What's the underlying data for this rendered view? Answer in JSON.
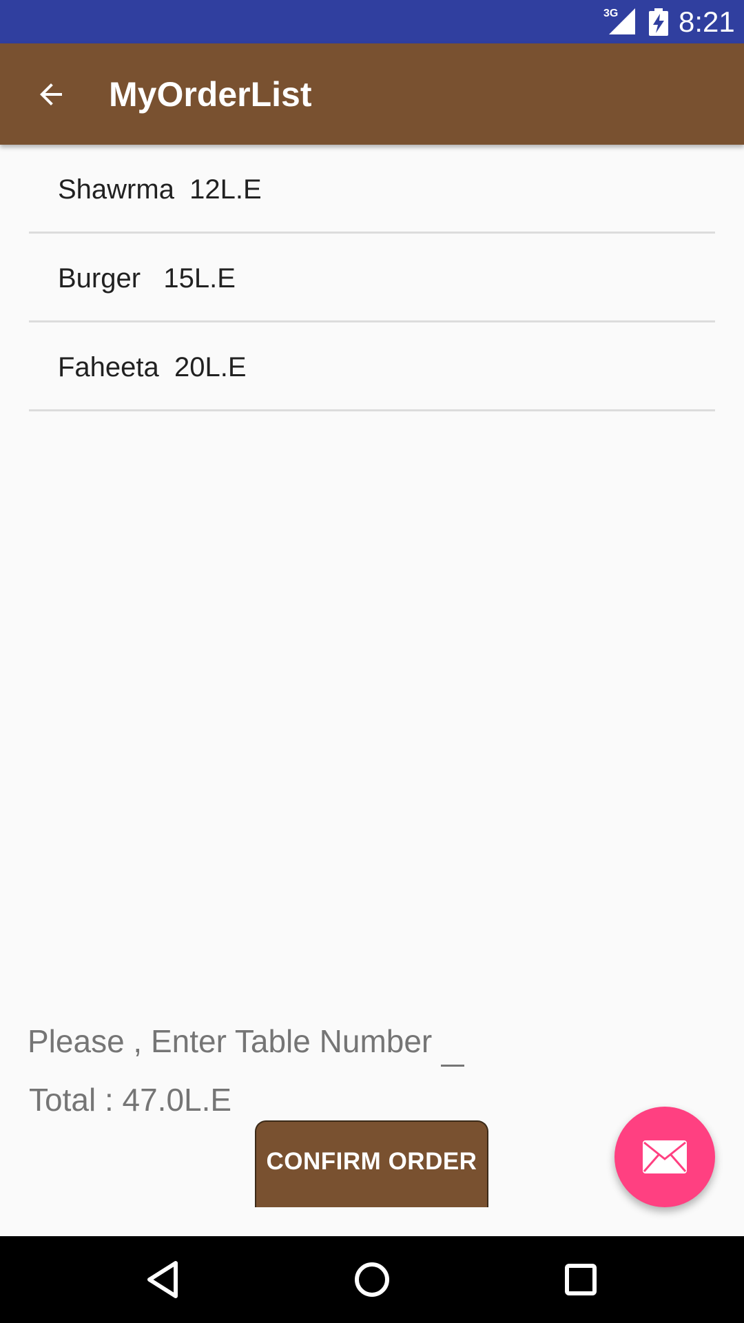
{
  "colors": {
    "status_bar": "#303f9f",
    "brand": "#795130",
    "fab": "#ff4081"
  },
  "status_bar": {
    "network_label": "3G",
    "time": "8:21"
  },
  "app_bar": {
    "title": "MyOrderList",
    "back_icon": "arrow-back-icon"
  },
  "orders": [
    {
      "text": "Shawrma  12L.E"
    },
    {
      "text": "Burger   15L.E"
    },
    {
      "text": "Faheeta  20L.E"
    }
  ],
  "table_input": {
    "value": "",
    "placeholder": "Please , Enter Table Number"
  },
  "total": {
    "text": "Total : 47.0L.E"
  },
  "confirm_button": {
    "label": "CONFIRM ORDER"
  },
  "fab": {
    "icon": "email-icon"
  },
  "nav_bar": {
    "back_icon": "nav-back-icon",
    "home_icon": "nav-home-icon",
    "recents_icon": "nav-recents-icon"
  }
}
